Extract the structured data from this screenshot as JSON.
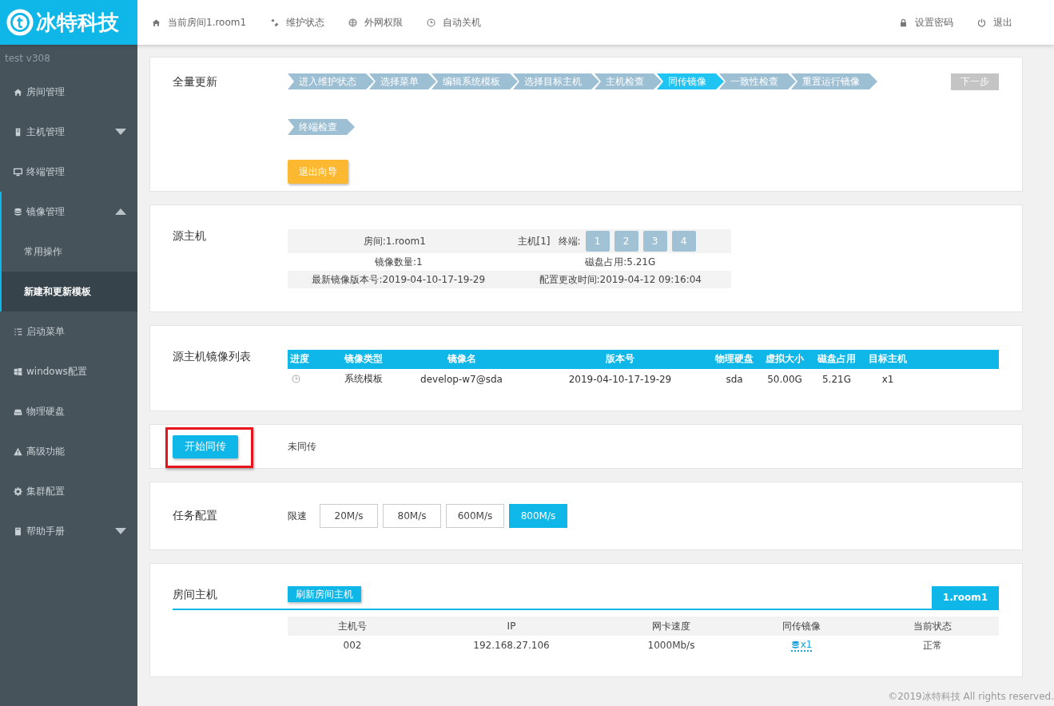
{
  "header": {
    "logo": "冰特科技",
    "nav": [
      {
        "label": "当前房间1.room1"
      },
      {
        "label": "维护状态"
      },
      {
        "label": "外网权限"
      },
      {
        "label": "自动关机"
      }
    ],
    "actions": [
      {
        "label": "设置密码"
      },
      {
        "label": "退出"
      }
    ]
  },
  "sidebar": {
    "version": "test  v308",
    "items": [
      {
        "label": "房间管理",
        "selected": false
      },
      {
        "label": "主机管理",
        "selected": false,
        "expanded": false
      },
      {
        "label": "终端管理",
        "selected": false
      },
      {
        "label": "镜像管理",
        "selected": false,
        "expanded": true,
        "children": [
          {
            "label": "常用操作",
            "selected": false
          },
          {
            "label": "新建和更新模板",
            "selected": true
          }
        ]
      },
      {
        "label": "启动菜单",
        "selected": false
      },
      {
        "label": "windows配置",
        "selected": false
      },
      {
        "label": "物理硬盘",
        "selected": false
      },
      {
        "label": "高级功能",
        "selected": false
      },
      {
        "label": "集群配置",
        "selected": false
      },
      {
        "label": "帮助手册",
        "selected": false,
        "expanded": false
      }
    ]
  },
  "wizard": {
    "title": "全量更新",
    "steps": [
      {
        "label": "进入维护状态",
        "selected": false
      },
      {
        "label": "选择菜单",
        "selected": false
      },
      {
        "label": "编辑系统模板",
        "selected": false
      },
      {
        "label": "选择目标主机",
        "selected": false
      },
      {
        "label": "主机检查",
        "selected": false
      },
      {
        "label": "同传镜像",
        "selected": true
      },
      {
        "label": "一致性检查",
        "selected": false
      },
      {
        "label": "重置运行镜像",
        "selected": false
      },
      {
        "label": "终端检查",
        "selected": false
      }
    ],
    "next_button": {
      "label": "下一步",
      "disabled": true
    },
    "exit_button": "退出向导"
  },
  "source_host": {
    "title": "源主机",
    "room": "房间:1.room1",
    "host": "主机[1]",
    "terminal_label": "终端:",
    "terminals": [
      "1",
      "2",
      "3",
      "4"
    ],
    "image_count": "镜像数量:1",
    "disk_usage": "磁盘占用:5.21G",
    "latest_version": "最新镜像版本号:2019-04-10-17-19-29",
    "config_time": "配置更改时间:2019-04-12 09:16:04"
  },
  "image_list": {
    "title": "源主机镜像列表",
    "columns": [
      "进度",
      "镜像类型",
      "镜像名",
      "版本号",
      "物理硬盘",
      "虚拟大小",
      "磁盘占用",
      "目标主机"
    ],
    "rows": [
      {
        "cells": [
          "",
          "系统模板",
          "develop-w7@sda",
          "2019-04-10-17-19-29",
          "sda",
          "50.00G",
          "5.21G",
          "x1"
        ]
      }
    ]
  },
  "sync": {
    "button": "开始同传",
    "highlighted": true,
    "status": "未同传"
  },
  "task_config": {
    "title": "任务配置",
    "speed_label": "限速",
    "options": [
      {
        "label": "20M/s",
        "selected": false
      },
      {
        "label": "80M/s",
        "selected": false
      },
      {
        "label": "600M/s",
        "selected": false
      },
      {
        "label": "800M/s",
        "selected": true
      }
    ]
  },
  "room_hosts": {
    "title": "房间主机",
    "refresh_button": "刷新房间主机",
    "tabs": [
      {
        "label": "1.room1",
        "selected": true
      }
    ],
    "columns": [
      "主机号",
      "IP",
      "网卡速度",
      "同传镜像",
      "当前状态"
    ],
    "rows": [
      {
        "cells": [
          "002",
          "192.168.27.106",
          "1000Mb/s",
          "x1",
          "正常"
        ]
      }
    ]
  },
  "footer": "©2019冰特科技 All rights reserved."
}
